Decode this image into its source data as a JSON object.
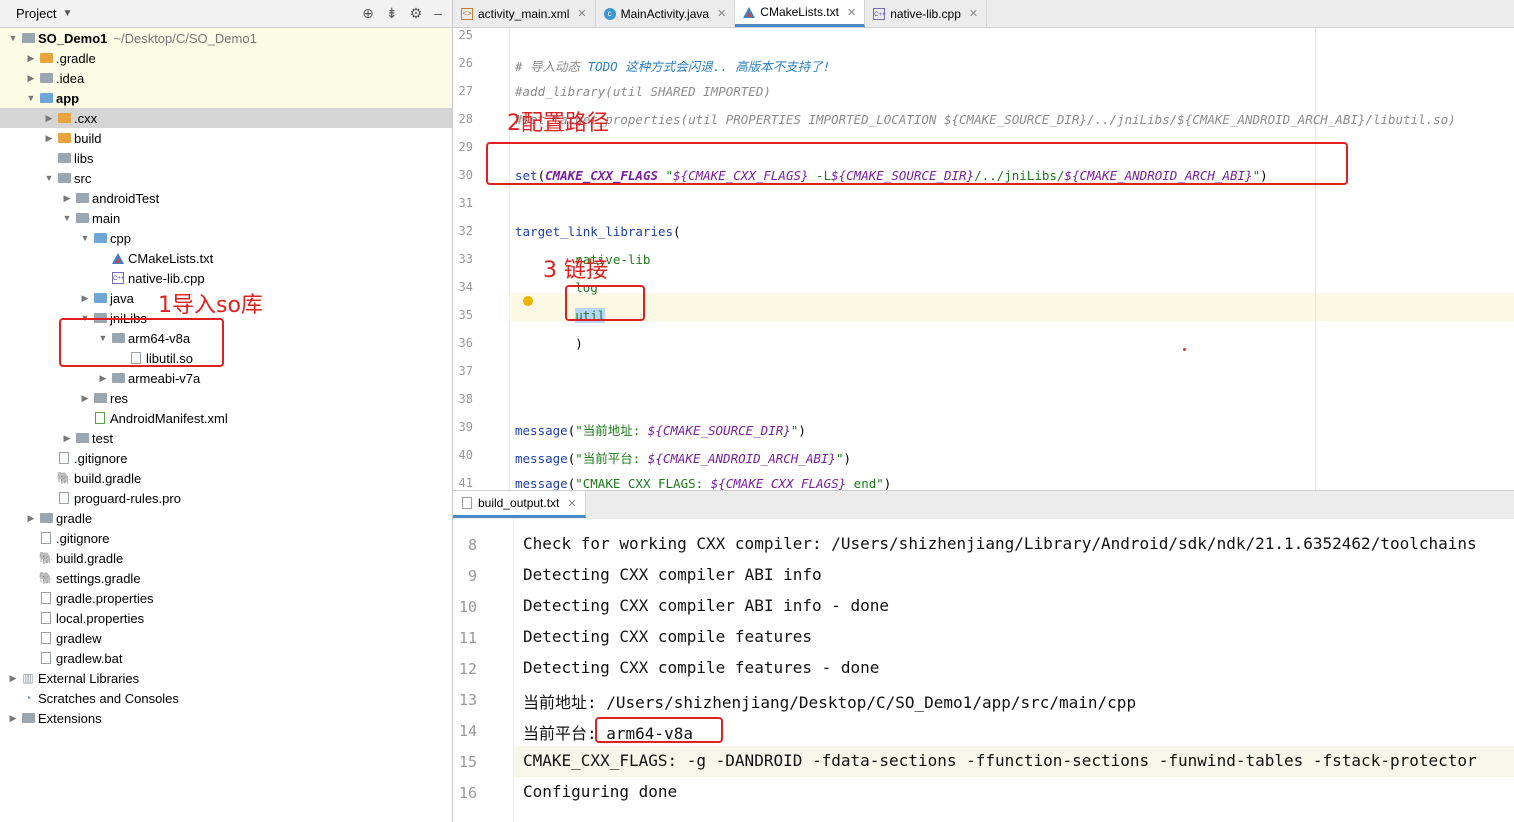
{
  "project_panel": {
    "title": "Project",
    "tree": [
      {
        "label": "SO_Demo1",
        "path": "~/Desktop/C/SO_Demo1",
        "depth": 0,
        "arrow": "open",
        "icon": "folder",
        "bold": true
      },
      {
        "label": ".gradle",
        "depth": 1,
        "arrow": "closed",
        "icon": "folder-orange"
      },
      {
        "label": ".idea",
        "depth": 1,
        "arrow": "closed",
        "icon": "folder"
      },
      {
        "label": "app",
        "depth": 1,
        "arrow": "open",
        "icon": "folder-blue",
        "bold": true
      },
      {
        "label": ".cxx",
        "depth": 2,
        "arrow": "closed",
        "icon": "folder-orange",
        "selected": true
      },
      {
        "label": "build",
        "depth": 2,
        "arrow": "closed",
        "icon": "folder-orange"
      },
      {
        "label": "libs",
        "depth": 2,
        "arrow": "none",
        "icon": "folder"
      },
      {
        "label": "src",
        "depth": 2,
        "arrow": "open",
        "icon": "folder"
      },
      {
        "label": "androidTest",
        "depth": 3,
        "arrow": "closed",
        "icon": "folder"
      },
      {
        "label": "main",
        "depth": 3,
        "arrow": "open",
        "icon": "folder"
      },
      {
        "label": "cpp",
        "depth": 4,
        "arrow": "open",
        "icon": "folder-blue"
      },
      {
        "label": "CMakeLists.txt",
        "depth": 5,
        "arrow": "none",
        "icon": "cmake"
      },
      {
        "label": "native-lib.cpp",
        "depth": 5,
        "arrow": "none",
        "icon": "cpp"
      },
      {
        "label": "java",
        "depth": 4,
        "arrow": "closed",
        "icon": "folder-blue"
      },
      {
        "label": "jniLibs",
        "depth": 4,
        "arrow": "open",
        "icon": "folder"
      },
      {
        "label": "arm64-v8a",
        "depth": 5,
        "arrow": "open",
        "icon": "folder"
      },
      {
        "label": "libutil.so",
        "depth": 6,
        "arrow": "none",
        "icon": "file"
      },
      {
        "label": "armeabi-v7a",
        "depth": 5,
        "arrow": "closed",
        "icon": "folder"
      },
      {
        "label": "res",
        "depth": 4,
        "arrow": "closed",
        "icon": "folder"
      },
      {
        "label": "AndroidManifest.xml",
        "depth": 4,
        "arrow": "none",
        "icon": "manifest"
      },
      {
        "label": "test",
        "depth": 3,
        "arrow": "closed",
        "icon": "folder"
      },
      {
        "label": ".gitignore",
        "depth": 2,
        "arrow": "none",
        "icon": "file"
      },
      {
        "label": "build.gradle",
        "depth": 2,
        "arrow": "none",
        "icon": "gradle"
      },
      {
        "label": "proguard-rules.pro",
        "depth": 2,
        "arrow": "none",
        "icon": "file"
      },
      {
        "label": "gradle",
        "depth": 1,
        "arrow": "closed",
        "icon": "folder"
      },
      {
        "label": ".gitignore",
        "depth": 1,
        "arrow": "none",
        "icon": "file"
      },
      {
        "label": "build.gradle",
        "depth": 1,
        "arrow": "none",
        "icon": "gradle"
      },
      {
        "label": "settings.gradle",
        "depth": 1,
        "arrow": "none",
        "icon": "gradle"
      },
      {
        "label": "gradle.properties",
        "depth": 1,
        "arrow": "none",
        "icon": "file"
      },
      {
        "label": "local.properties",
        "depth": 1,
        "arrow": "none",
        "icon": "file"
      },
      {
        "label": "gradlew",
        "depth": 1,
        "arrow": "none",
        "icon": "file"
      },
      {
        "label": "gradlew.bat",
        "depth": 1,
        "arrow": "none",
        "icon": "file"
      },
      {
        "label": "External Libraries",
        "depth": 0,
        "arrow": "closed",
        "icon": "libs"
      },
      {
        "label": "Scratches and Consoles",
        "depth": 0,
        "arrow": "none",
        "icon": "scratch"
      },
      {
        "label": "Extensions",
        "depth": 0,
        "arrow": "closed",
        "icon": "folder"
      }
    ]
  },
  "editor_tabs": [
    {
      "label": "activity_main.xml",
      "icon": "xml-file-icon",
      "active": false
    },
    {
      "label": "MainActivity.java",
      "icon": "java-class-icon",
      "active": false
    },
    {
      "label": "CMakeLists.txt",
      "icon": "cmake-icon",
      "active": true
    },
    {
      "label": "native-lib.cpp",
      "icon": "cpp-file-icon",
      "active": false
    }
  ],
  "editor": {
    "lines": [
      {
        "n": "25",
        "parts": []
      },
      {
        "n": "26",
        "parts": [
          {
            "t": "# 导入动态 ",
            "c": "c-com"
          },
          {
            "t": "TODO 这种方式会闪退.. 高版本不支持了!",
            "c": "c-todo"
          }
        ]
      },
      {
        "n": "27",
        "parts": [
          {
            "t": "#add_library(util SHARED IMPORTED)",
            "c": "c-com"
          }
        ]
      },
      {
        "n": "28",
        "parts": [
          {
            "t": "#set_target_properties(util PROPERTIES IMPORTED_LOCATION ${CMAKE_SOURCE_DIR}/../jniLibs/${CMAKE_ANDROID_ARCH_ABI}/libutil.so)",
            "c": "c-com"
          }
        ]
      },
      {
        "n": "29",
        "parts": []
      },
      {
        "n": "30",
        "parts": [
          {
            "t": "set",
            "c": "c-cmd"
          },
          {
            "t": "(",
            "c": ""
          },
          {
            "t": "CMAKE_CXX_FLAGS",
            "c": "c-var"
          },
          {
            "t": " \"",
            "c": "c-str"
          },
          {
            "t": "${CMAKE_CXX_FLAGS}",
            "c": "c-strv"
          },
          {
            "t": " -L",
            "c": "c-str"
          },
          {
            "t": "${CMAKE_SOURCE_DIR}",
            "c": "c-strv"
          },
          {
            "t": "/../jniLibs/",
            "c": "c-str"
          },
          {
            "t": "${CMAKE_ANDROID_ARCH_ABI}",
            "c": "c-strv"
          },
          {
            "t": "\"",
            "c": "c-str"
          },
          {
            "t": ")",
            "c": ""
          }
        ]
      },
      {
        "n": "31",
        "parts": []
      },
      {
        "n": "32",
        "parts": [
          {
            "t": "target_link_libraries",
            "c": "c-cmd"
          },
          {
            "t": "(",
            "c": ""
          }
        ]
      },
      {
        "n": "33",
        "parts": [
          {
            "t": "        native-lib",
            "c": "c-arg"
          }
        ]
      },
      {
        "n": "34",
        "parts": [
          {
            "t": "        log",
            "c": "c-arg"
          }
        ]
      },
      {
        "n": "35",
        "parts": [
          {
            "t": "        ",
            "c": ""
          },
          {
            "t": "util",
            "c": "c-arg c-sel"
          }
        ]
      },
      {
        "n": "36",
        "parts": [
          {
            "t": "        )",
            "c": ""
          }
        ]
      },
      {
        "n": "37",
        "parts": []
      },
      {
        "n": "38",
        "parts": []
      },
      {
        "n": "39",
        "parts": [
          {
            "t": "message",
            "c": "c-cmd"
          },
          {
            "t": "(",
            "c": ""
          },
          {
            "t": "\"当前地址: ",
            "c": "c-str"
          },
          {
            "t": "${CMAKE_SOURCE_DIR}",
            "c": "c-strv"
          },
          {
            "t": "\"",
            "c": "c-str"
          },
          {
            "t": ")",
            "c": ""
          }
        ]
      },
      {
        "n": "40",
        "parts": [
          {
            "t": "message",
            "c": "c-cmd"
          },
          {
            "t": "(",
            "c": ""
          },
          {
            "t": "\"当前平台: ",
            "c": "c-str"
          },
          {
            "t": "${CMAKE_ANDROID_ARCH_ABI}",
            "c": "c-strv"
          },
          {
            "t": "\"",
            "c": "c-str"
          },
          {
            "t": ")",
            "c": ""
          }
        ]
      },
      {
        "n": "41",
        "parts": [
          {
            "t": "message",
            "c": "c-cmd"
          },
          {
            "t": "(",
            "c": ""
          },
          {
            "t": "\"CMAKE_CXX_FLAGS: ",
            "c": "c-str"
          },
          {
            "t": "${CMAKE_CXX_FLAGS}",
            "c": "c-strv"
          },
          {
            "t": " end\"",
            "c": "c-str"
          },
          {
            "t": ")",
            "c": ""
          }
        ]
      }
    ]
  },
  "output_tab": {
    "label": "build_output.txt"
  },
  "output": {
    "lines": [
      {
        "n": "8",
        "text": "Check for working CXX compiler: /Users/shizhenjiang/Library/Android/sdk/ndk/21.1.6352462/toolchains"
      },
      {
        "n": "9",
        "text": "Detecting CXX compiler ABI info"
      },
      {
        "n": "10",
        "text": "Detecting CXX compiler ABI info - done"
      },
      {
        "n": "11",
        "text": "Detecting CXX compile features"
      },
      {
        "n": "12",
        "text": "Detecting CXX compile features - done"
      },
      {
        "n": "13",
        "text": "当前地址: /Users/shizhenjiang/Desktop/C/SO_Demo1/app/src/main/cpp"
      },
      {
        "n": "14",
        "text": "当前平台: arm64-v8a"
      },
      {
        "n": "15",
        "text": "CMAKE_CXX_FLAGS: -g -DANDROID -fdata-sections -ffunction-sections -funwind-tables -fstack-protector"
      },
      {
        "n": "16",
        "text": "Configuring done"
      }
    ]
  },
  "annotations": {
    "import_so": "1导入so库",
    "config_path": "2配置路径",
    "link": "3 链接"
  },
  "colors": {
    "annotation_red": "#e02020",
    "accent_tab": "#4a88c7"
  }
}
